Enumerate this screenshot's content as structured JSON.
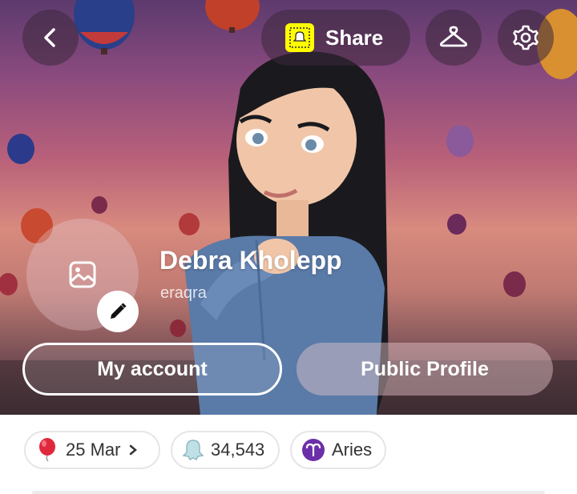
{
  "header": {
    "share_label": "Share",
    "back_icon": "chevron-left-icon",
    "outfit_icon": "hanger-icon",
    "settings_icon": "gear-icon"
  },
  "profile": {
    "display_name": "Debra Kholepp",
    "username": "eraqra",
    "photo_icon": "image-icon",
    "edit_icon": "pencil-icon"
  },
  "actions": {
    "my_account_label": "My account",
    "public_profile_label": "Public Profile"
  },
  "chips": {
    "birthday": {
      "label": "25 Mar",
      "icon": "balloon-icon"
    },
    "score": {
      "label": "34,543",
      "icon": "ghost-icon"
    },
    "zodiac": {
      "label": "Aries",
      "icon": "aries-icon"
    }
  },
  "colors": {
    "snap_yellow": "#fffc00",
    "zodiac_purple": "#6b2fa8",
    "balloon_red": "#e0283c"
  }
}
